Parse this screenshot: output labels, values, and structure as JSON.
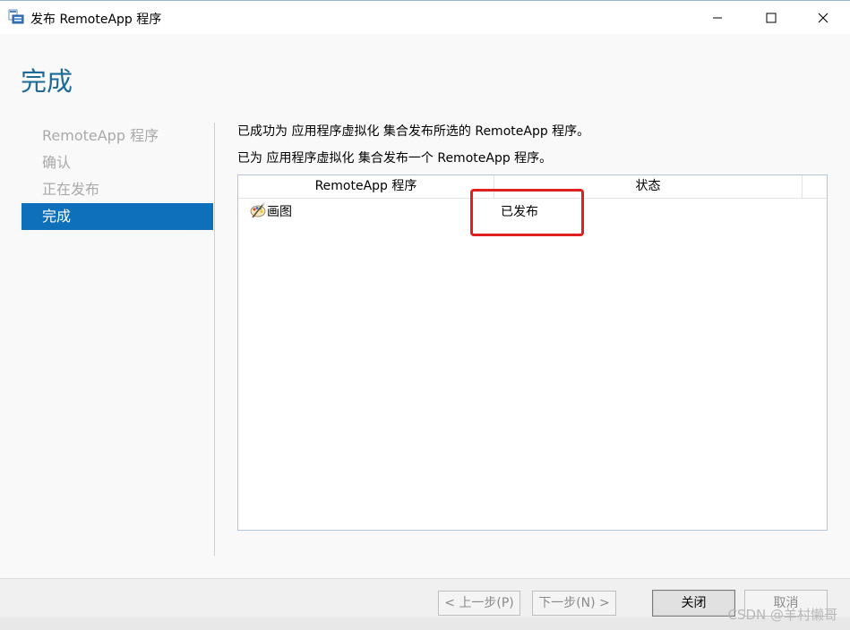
{
  "window": {
    "title": "发布 RemoteApp 程序",
    "icon": "remoteapp-publish-icon",
    "controls": [
      "minimize-icon",
      "maximize-icon",
      "close-icon"
    ]
  },
  "page": {
    "heading": "完成"
  },
  "nav": {
    "items": [
      {
        "label": "RemoteApp 程序",
        "state": "inactive"
      },
      {
        "label": "确认",
        "state": "inactive"
      },
      {
        "label": "正在发布",
        "state": "inactive"
      },
      {
        "label": "完成",
        "state": "active"
      }
    ],
    "active_color": "#0e6fbb"
  },
  "main": {
    "message1": "已成功为 应用程序虚拟化 集合发布所选的 RemoteApp 程序。",
    "message2": "已为 应用程序虚拟化 集合发布一个 RemoteApp 程序。",
    "table": {
      "columns": [
        "RemoteApp 程序",
        "状态"
      ],
      "rows": [
        {
          "name": "画图",
          "status": "已发布",
          "icon": "paint-icon"
        }
      ]
    },
    "highlight_color": "#e0201f"
  },
  "footer": {
    "prev_label": "< 上一步(P)",
    "next_label": "下一步(N) >",
    "close_label": "关闭",
    "cancel_label": "取消"
  },
  "watermark": "CSDN @羊村懒哥",
  "colors": {
    "heading": "#1d6a99",
    "nav_inactive": "#a9a9a9"
  }
}
